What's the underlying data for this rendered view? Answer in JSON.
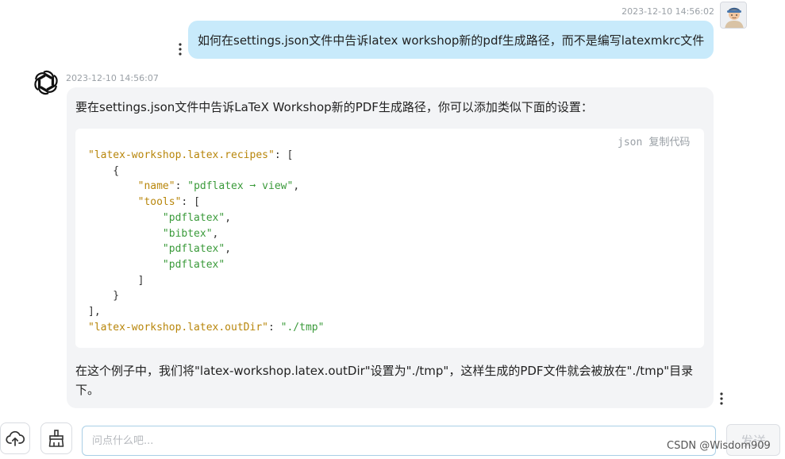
{
  "user_message": {
    "timestamp": "2023-12-10 14:56:02",
    "text": "如何在settings.json文件中告诉latex workshop新的pdf生成路径，而不是编写latexmkrc文件"
  },
  "assistant_message": {
    "timestamp": "2023-12-10 14:56:07",
    "intro": "要在settings.json文件中告诉LaTeX Workshop新的PDF生成路径，你可以添加类似下面的设置：",
    "code_lang": "json",
    "copy_label": "复制代码",
    "outro": "在这个例子中，我们将\"latex-workshop.latex.outDir\"设置为\"./tmp\"，这样生成的PDF文件就会被放在\"./tmp\"目录下。"
  },
  "code_tokens": {
    "recipes_key": "\"latex-workshop.latex.recipes\"",
    "name_key": "\"name\"",
    "name_val": "\"pdflatex ➞ view\"",
    "tools_key": "\"tools\"",
    "tool_1": "\"pdflatex\"",
    "tool_2": "\"bibtex\"",
    "tool_3": "\"pdflatex\"",
    "tool_4": "\"pdflatex\"",
    "outdir_key": "\"latex-workshop.latex.outDir\"",
    "outdir_val": "\"./tmp\""
  },
  "input": {
    "placeholder": "问点什么吧...",
    "value": ""
  },
  "send_label": "发送",
  "watermark": "CSDN @Wisdom909",
  "icons": {
    "upload": "cloud-upload-icon",
    "clear": "broom-icon",
    "more": "more-vertical-icon"
  },
  "colors": {
    "user_bubble": "#c8eafb",
    "assistant_bubble": "#f3f4f6",
    "json_key": "#b8860b",
    "json_string": "#3a9a3a"
  }
}
